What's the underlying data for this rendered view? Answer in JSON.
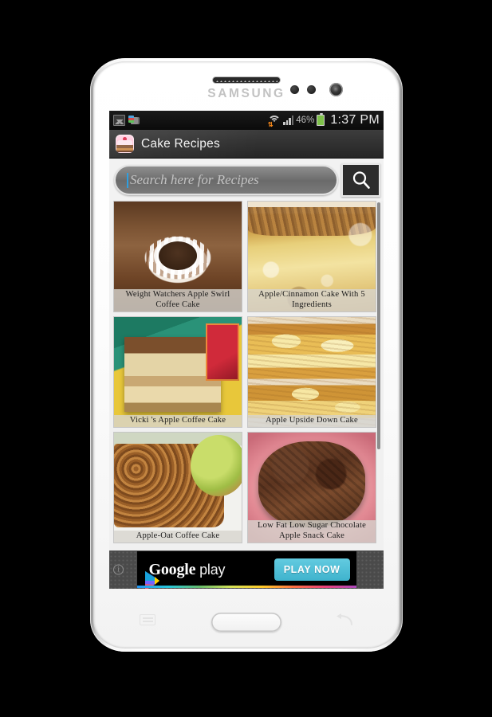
{
  "device": {
    "brand": "SAMSUNG",
    "earpiece_name": "earpiece-speaker",
    "home_button_name": "home-button",
    "menu_key_name": "menu-key",
    "back_key_name": "back-key"
  },
  "status_bar": {
    "left_icons": [
      {
        "name": "gallery-icon",
        "label": "Gallery"
      },
      {
        "name": "printer-icon",
        "label": "Printer"
      }
    ],
    "wifi_label": "WiFi",
    "signal_label": "Signal",
    "battery_percent": "46%",
    "clock": "1:37 PM"
  },
  "action_bar": {
    "app_icon_name": "cake-app-icon",
    "title": "Cake Recipes"
  },
  "search": {
    "placeholder": "Search here for Recipes",
    "value": "",
    "button_icon": "search-icon"
  },
  "grid": {
    "cards": [
      {
        "title": "Weight Watchers Apple Swirl Coffee Cake",
        "photo_class": "ph-bundt"
      },
      {
        "title": "Apple/Cinnamon Cake With 5 Ingredients",
        "photo_class": "ph-cinn"
      },
      {
        "title": "Vicki 's Apple Coffee Cake",
        "photo_class": "ph-vicki"
      },
      {
        "title": "Apple Upside Down Cake",
        "photo_class": "ph-upside"
      },
      {
        "title": "Apple-Oat Coffee Cake",
        "photo_class": "ph-oat"
      },
      {
        "title": "Low Fat Low Sugar Chocolate Apple Snack Cake",
        "photo_class": "ph-choc"
      }
    ]
  },
  "ad": {
    "info_icon": "info-icon",
    "brand_main": "Google",
    "brand_sub": " play",
    "cta_label": "PLAY NOW",
    "accent_color": "#4ec0d6"
  }
}
